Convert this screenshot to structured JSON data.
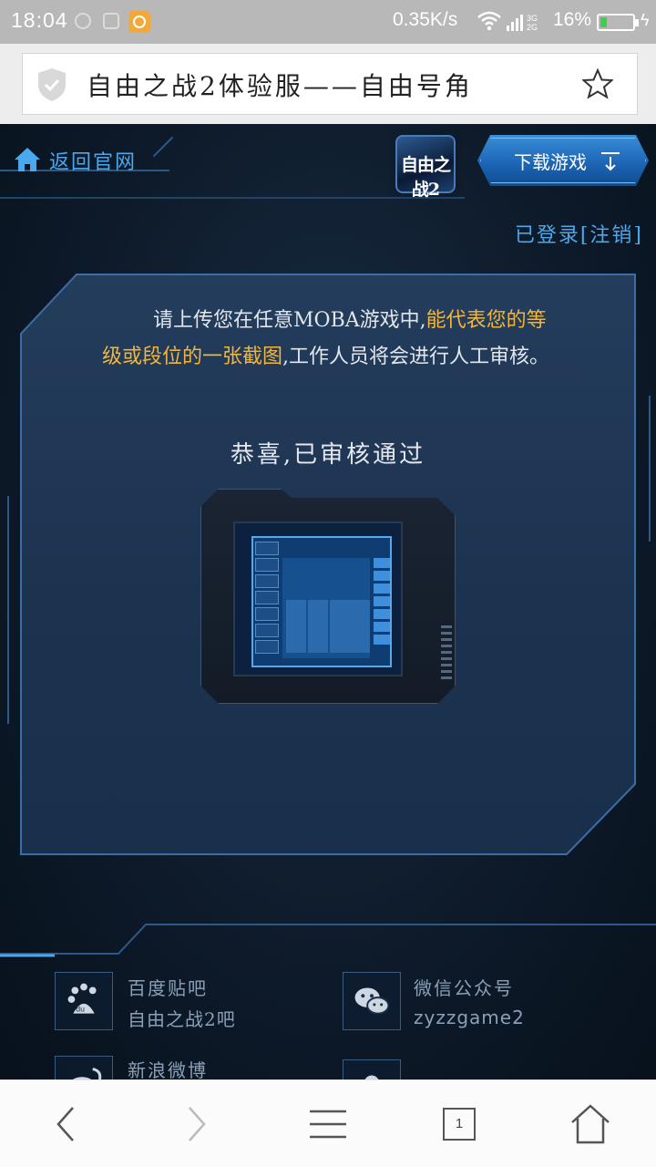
{
  "status_bar": {
    "time": "18:04",
    "net_speed": "0.35K/s",
    "battery_pct": "16%",
    "battery_level": 0.16,
    "network": "3G 2G"
  },
  "browser": {
    "page_title": "自由之战2体验服——自由号角",
    "tab_count": "1"
  },
  "header": {
    "back_label": "返回官网",
    "logo_text": "自由之战2",
    "download_label": "下载游戏"
  },
  "account": {
    "status": "已登录",
    "logout": "[注销]"
  },
  "main": {
    "intro_part1": "请上传您在任意MOBA游戏中,",
    "intro_highlight": "能代表您的等级或段位的一张截图",
    "intro_part2": ",工作人员将会进行人工审核。",
    "approved": "恭喜,已审核通过"
  },
  "footer": {
    "items": [
      {
        "title": "百度贴吧",
        "subtitle": "自由之战2吧",
        "icon": "baidu-tieba-icon"
      },
      {
        "title": "微信公众号",
        "subtitle": "zyzzgame2",
        "icon": "wechat-icon"
      },
      {
        "title": "新浪微博",
        "subtitle": "",
        "icon": "weibo-icon"
      },
      {
        "title": "",
        "subtitle": "",
        "icon": "qq-icon"
      }
    ]
  },
  "colors": {
    "link_blue": "#49a8ee",
    "highlight_orange": "#f3b53a",
    "download_blue": "#1d66b6"
  }
}
